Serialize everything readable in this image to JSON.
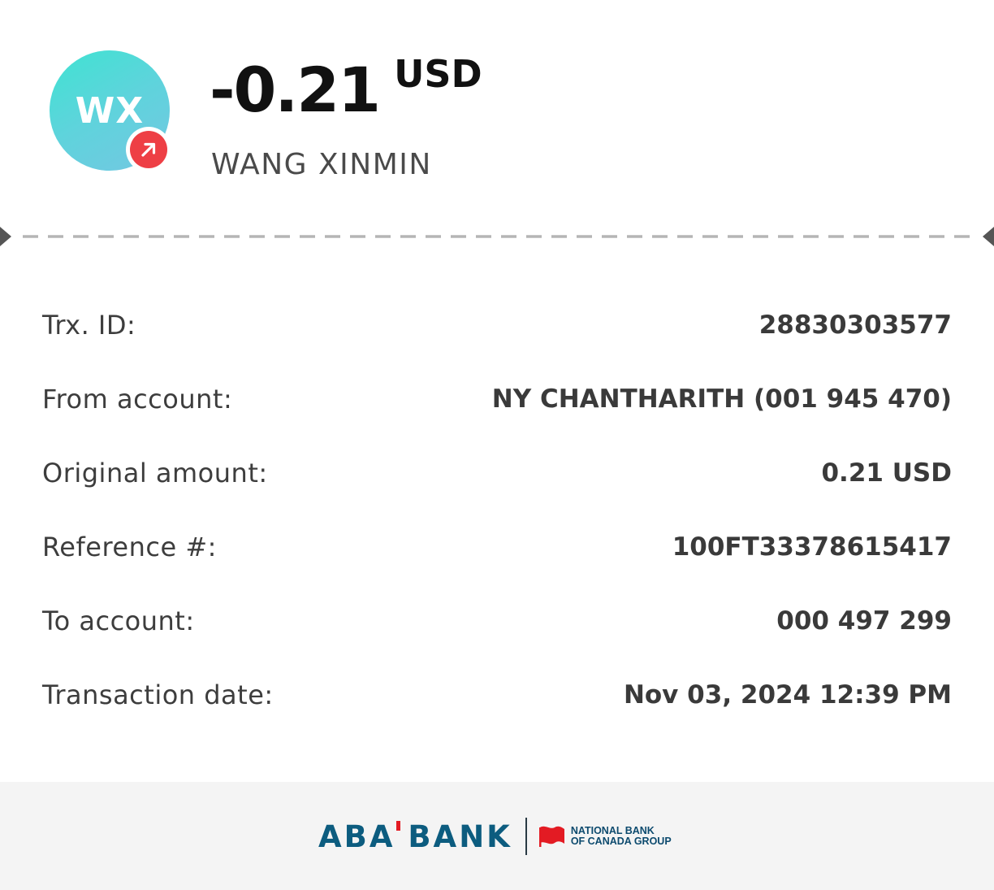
{
  "header": {
    "avatar_initials": "WX",
    "direction_icon": "arrow-up-right-icon",
    "amount": "-0.21",
    "currency": "USD",
    "recipient_name": "WANG XINMIN"
  },
  "details": [
    {
      "label": "Trx. ID:",
      "value": "28830303577"
    },
    {
      "label": "From account:",
      "value": "NY CHANTHARITH (001 945 470)"
    },
    {
      "label": "Original amount:",
      "value": "0.21 USD"
    },
    {
      "label": "Reference #:",
      "value": "100FT33378615417"
    },
    {
      "label": "To account:",
      "value": "000 497 299"
    },
    {
      "label": "Transaction date:",
      "value": "Nov 03, 2024 12:39 PM"
    }
  ],
  "footer": {
    "bank_name": "ABA BANK",
    "partner_line1": "NATIONAL BANK",
    "partner_line2": "OF CANADA GROUP"
  },
  "colors": {
    "avatar_gradient_start": "#3fe3d2",
    "avatar_gradient_end": "#74c7e2",
    "outgoing_badge": "#ee3f45",
    "aba_blue": "#0c5c7f",
    "nbc_red": "#e31b23",
    "footer_bg": "#f4f4f4"
  }
}
